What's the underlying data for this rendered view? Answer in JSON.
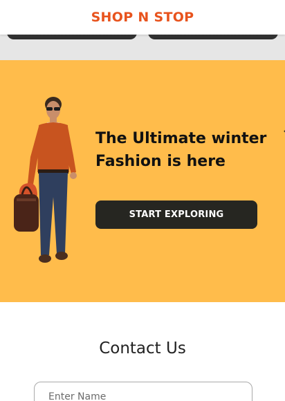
{
  "header": {
    "brand": "SHOP N STOP"
  },
  "hero": {
    "title": "The Ultimate winter Fashion is here",
    "cta_label": "START EXPLORING",
    "next_glyph": "‹"
  },
  "contact": {
    "title": "Contact Us",
    "name_placeholder": "Enter Name"
  },
  "colors": {
    "brand": "#e8531d",
    "hero_bg": "#ffbc4b",
    "cta_bg": "#262621"
  }
}
